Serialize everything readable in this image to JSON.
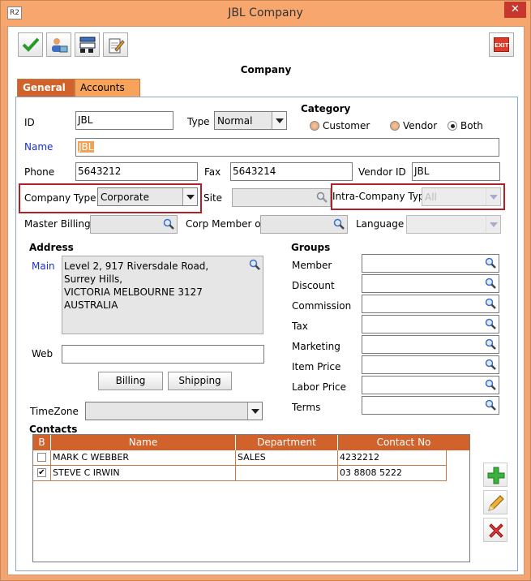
{
  "window": {
    "title": "JBL Company",
    "app_icon_text": "R2",
    "close_glyph": "✕"
  },
  "toolbar": {
    "exit_label": "EXIT"
  },
  "page_title": "Company",
  "tabs": [
    {
      "label": "General"
    },
    {
      "label": "Accounts"
    }
  ],
  "form": {
    "id_label": "ID",
    "id_value": "JBL",
    "type_label": "Type",
    "type_value": "Normal",
    "category_label": "Category",
    "category_options": [
      "Customer",
      "Vendor",
      "Both"
    ],
    "category_selected": "Both",
    "name_label": "Name",
    "name_value": "JBL",
    "phone_label": "Phone",
    "phone_value": "5643212",
    "fax_label": "Fax",
    "fax_value": "5643214",
    "vendor_id_label": "Vendor ID",
    "vendor_id_value": "JBL",
    "company_type_label": "Company Type",
    "company_type_value": "Corporate",
    "site_label": "Site",
    "site_value": "",
    "intra_company_type_label": "Intra-Company Type",
    "intra_company_type_value": "All",
    "master_billing_label": "Master Billing",
    "master_billing_value": "",
    "corp_member_label": "Corp Member of",
    "corp_member_value": "",
    "language_label": "Language",
    "language_value": ""
  },
  "address": {
    "section_label": "Address",
    "main_label": "Main",
    "main_lines": [
      "Level 2, 917 Riversdale Road,",
      "Surrey Hills,",
      "VICTORIA MELBOURNE 3127",
      "AUSTRALIA"
    ],
    "web_label": "Web",
    "web_value": "",
    "billing_button": "Billing",
    "shipping_button": "Shipping",
    "timezone_label": "TimeZone",
    "timezone_value": ""
  },
  "groups": {
    "section_label": "Groups",
    "items": [
      {
        "label": "Member",
        "value": ""
      },
      {
        "label": "Discount",
        "value": ""
      },
      {
        "label": "Commission",
        "value": ""
      },
      {
        "label": "Tax",
        "value": ""
      },
      {
        "label": "Marketing",
        "value": ""
      },
      {
        "label": "Item Price",
        "value": ""
      },
      {
        "label": "Labor Price",
        "value": ""
      },
      {
        "label": "Terms",
        "value": ""
      }
    ]
  },
  "contacts": {
    "section_label": "Contacts",
    "columns": [
      "B",
      "Name",
      "Department",
      "Contact No"
    ],
    "rows": [
      {
        "checked": false,
        "name": "MARK C WEBBER",
        "department": "SALES",
        "contact_no": "4232212"
      },
      {
        "checked": true,
        "name": "STEVE C IRWIN",
        "department": "",
        "contact_no": "03 8808 5222"
      }
    ],
    "check_glyph": "✔"
  },
  "colors": {
    "accent": "#d1622c",
    "tab_inactive": "#f7a359",
    "label_blue": "#1a2fd0",
    "highlight_box": "#b0202b"
  }
}
